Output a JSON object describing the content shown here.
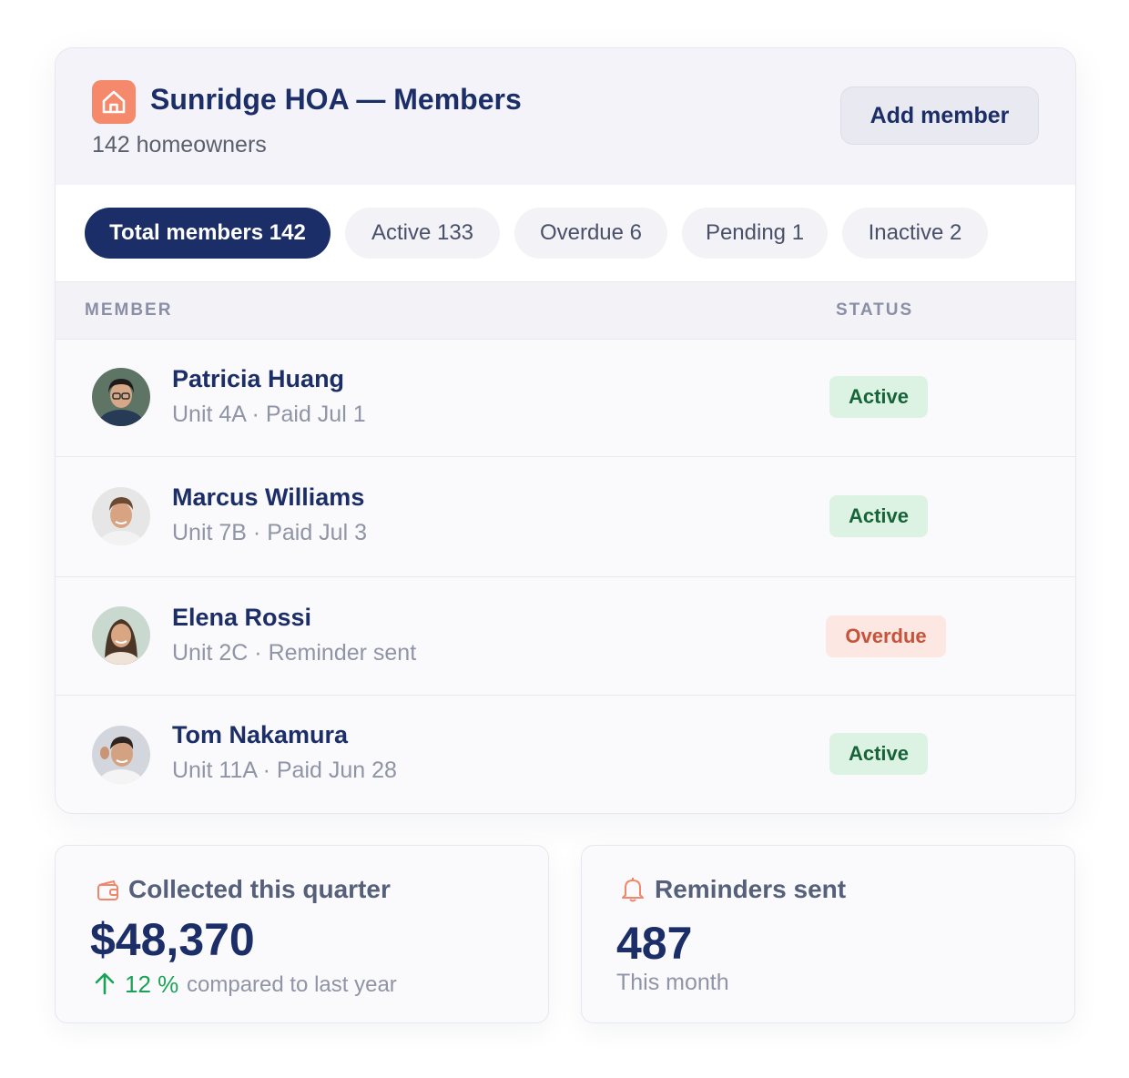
{
  "header": {
    "title": "Sunridge HOA — Members",
    "subtitle": "142 homeowners",
    "add_button": "Add member",
    "logo_icon": "home-icon",
    "accent": "#f4896c"
  },
  "tabs": [
    {
      "label": "Total members 142",
      "active": true
    },
    {
      "label": "Active 133",
      "active": false
    },
    {
      "label": "Overdue 6",
      "active": false
    },
    {
      "label": "Pending 1",
      "active": false
    },
    {
      "label": "Inactive 2",
      "active": false
    }
  ],
  "table": {
    "columns": {
      "member": "MEMBER",
      "status": "STATUS"
    },
    "rows": [
      {
        "name": "Patricia Huang",
        "detail": "Unit 4A · Paid Jul 1",
        "status": "Active"
      },
      {
        "name": "Marcus Williams",
        "detail": "Unit 7B · Paid Jul 3",
        "status": "Active"
      },
      {
        "name": "Elena Rossi",
        "detail": "Unit 2C · Reminder sent",
        "status": "Overdue"
      },
      {
        "name": "Tom Nakamura",
        "detail": "Unit 11A · Paid Jun 28",
        "status": "Active"
      }
    ]
  },
  "stats": {
    "collected": {
      "icon": "wallet-icon",
      "label": "Collected this quarter",
      "value": "$48,370",
      "trend_value": "12 %",
      "trend_text": "compared to last year"
    },
    "reminders": {
      "icon": "bell-icon",
      "label": "Reminders sent",
      "value": "487",
      "caption": "This month"
    }
  },
  "colors": {
    "navy": "#1c2e67",
    "active_bg": "#dcf3e3",
    "active_fg": "#17643a",
    "overdue_bg": "#fde7e2",
    "overdue_fg": "#c5543a",
    "trend_green": "#1aa356"
  }
}
